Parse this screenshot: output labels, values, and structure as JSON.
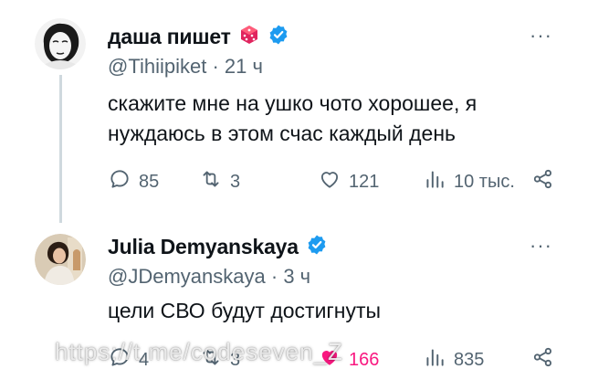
{
  "tweets": [
    {
      "display_name": "даша пишет",
      "name_emoji": "dice-icon",
      "verified": true,
      "handle": "@Tihiipiket",
      "time": "21 ч",
      "text": "скажите мне на ушко чото хорошее, я нуждаюсь в этом счас каждый день",
      "replies": "85",
      "retweets": "3",
      "likes": "121",
      "views": "10 тыс."
    },
    {
      "display_name": "Julia Demyanskaya",
      "verified": true,
      "handle": "@JDemyanskaya",
      "time": "3 ч",
      "text": "цели СВО будут достигнуты",
      "replies": "4",
      "retweets": "3",
      "likes": "166",
      "views": "835"
    }
  ],
  "handle_time_sep": "·",
  "more_label": "···",
  "watermark": "https://t.me/codeseven_Z",
  "colors": {
    "verified": "#1d9bf0",
    "muted": "#536471",
    "like": "#f91880",
    "thread_line": "#cfd9de"
  }
}
